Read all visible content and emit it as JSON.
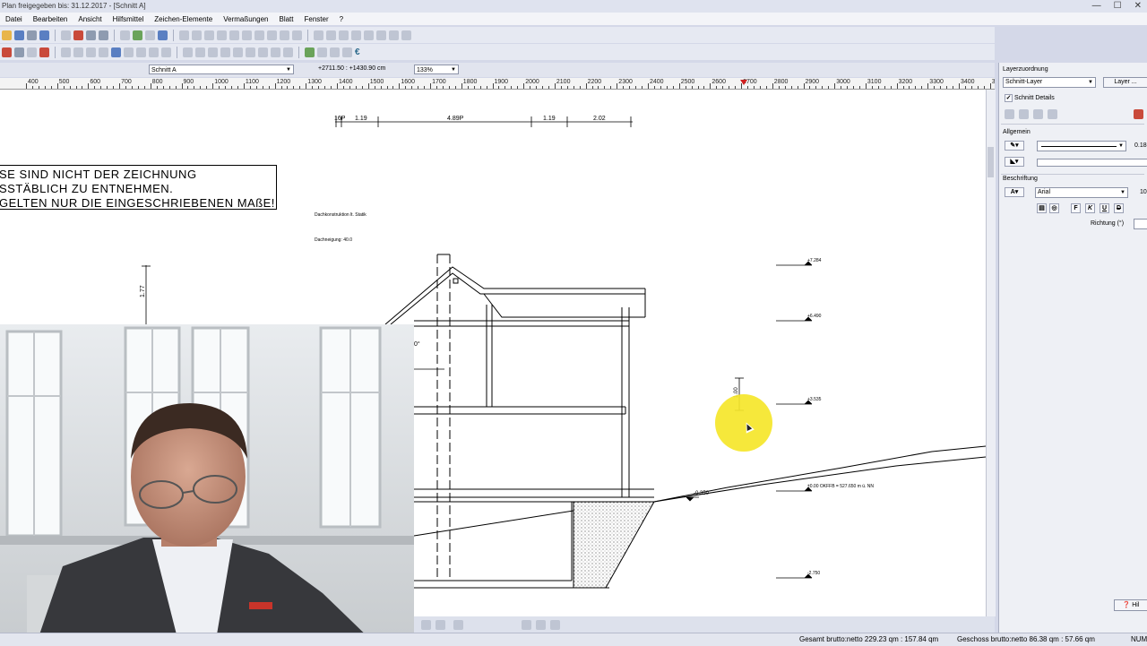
{
  "window": {
    "title": "Plan freigegeben bis: 31.12.2017 - [Schnitt A]",
    "controls": {
      "minimize": "—",
      "maximize": "☐",
      "close": "✕"
    }
  },
  "menu": [
    "Datei",
    "Bearbeiten",
    "Ansicht",
    "Hilfsmittel",
    "Zeichen-Elemente",
    "Vermaßungen",
    "Blatt",
    "Fenster",
    "?"
  ],
  "toolbar": {
    "euro_symbol": "€"
  },
  "viewbar": {
    "view_name": "Schnitt A",
    "coordinates": "+2711.50 : +1430.90 cm",
    "zoom": "133%"
  },
  "ruler": {
    "labels": [
      "400",
      "500",
      "600",
      "700",
      "800",
      "900",
      "1000",
      "1100",
      "1200",
      "1300",
      "1400",
      "1500",
      "1600",
      "1700",
      "1800",
      "1900",
      "2000",
      "2100",
      "2200",
      "2300",
      "2400",
      "2500",
      "2600",
      "2700",
      "2800",
      "2900",
      "3000",
      "3100",
      "3200",
      "3300",
      "3400",
      "35"
    ]
  },
  "drawing": {
    "note_lines": [
      "SE SIND NICHT DER ZEICHNUNG",
      "SSTÄBLICH ZU ENTNEHMEN.",
      "GELTEN NUR DIE EINGESCHRIEBENEN MAßE!"
    ],
    "top_dimensions": [
      "16P",
      "1.19",
      "4.89P",
      "1.19",
      "2.02"
    ],
    "left_dimension": "1.77",
    "annotation_1": "Dachkonstruktion lt. Statik",
    "annotation_2": "Dachneigung: 40.0",
    "angle_label": "0°",
    "right_dimension": "1.00",
    "levels": [
      "+7.284",
      "+6.490",
      "+3.535",
      "±0.00 OKFFB = 527.650 m ü. NN",
      "-0.350",
      "-2.750"
    ]
  },
  "layer_panel": {
    "title": "Layerzuordnung",
    "layer_value": "Schnitt-Layer",
    "layer_button": "Layer ...",
    "checkbox_label": "Schnitt Details",
    "section_general": "Allgemein",
    "line_width": "0.18",
    "section_labeling": "Beschriftung",
    "font_value": "Arial",
    "font_size": "10",
    "style_buttons": [
      "F",
      "K",
      "U",
      "D"
    ],
    "direction_label": "Richtung (°)",
    "help_button": "Hil"
  },
  "statusbar": {
    "gross_total": "Gesamt brutto:netto 229.23 qm : 157.84 qm",
    "floor_total": "Geschoss brutto:netto 86.38 qm : 57.66 qm",
    "num": "NUM"
  },
  "colors": {
    "highlight": "#f5e62a",
    "panel_bg": "#eef0f5",
    "toolbar_bg": "#e6e9f2"
  }
}
